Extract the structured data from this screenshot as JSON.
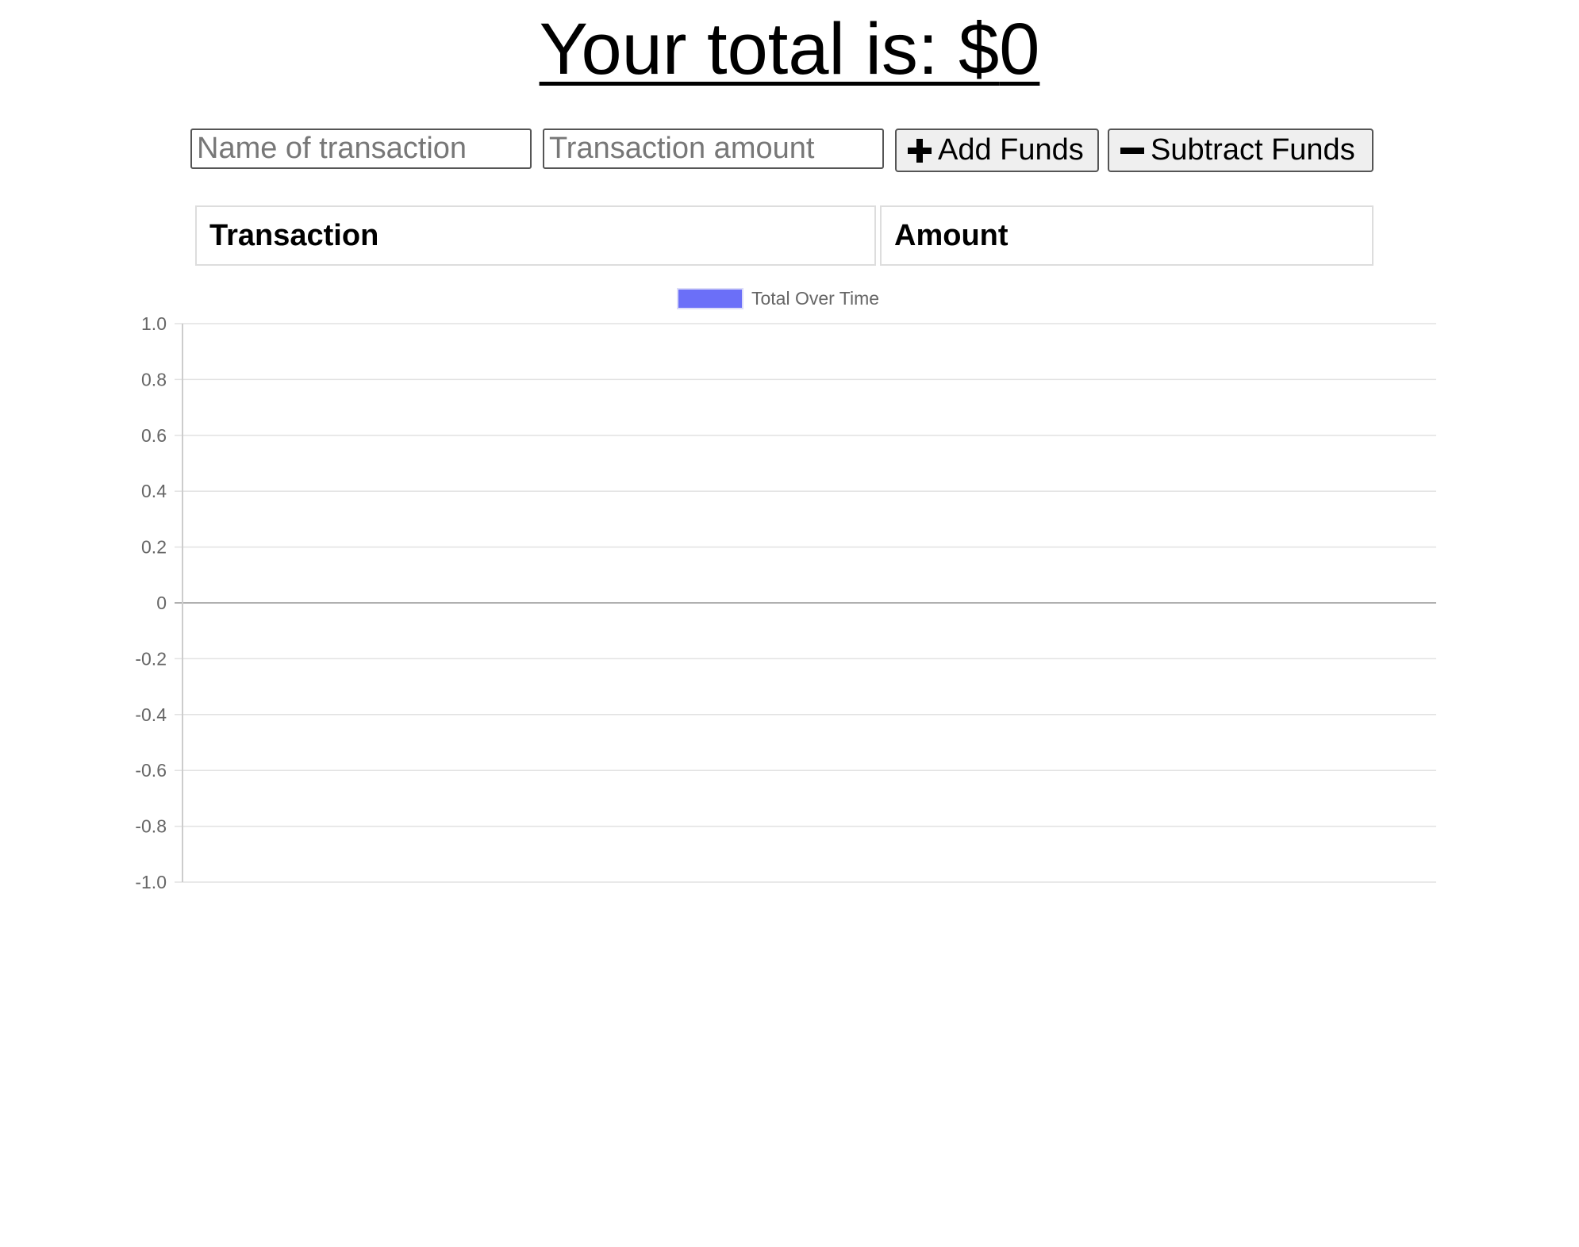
{
  "header": {
    "title_prefix": "Your total is: $",
    "total": "0"
  },
  "form": {
    "name_placeholder": "Name of transaction",
    "amount_placeholder": "Transaction amount",
    "name_value": "",
    "amount_value": "",
    "add_label": "Add Funds",
    "subtract_label": "Subtract Funds"
  },
  "table": {
    "headers": [
      "Transaction",
      "Amount"
    ],
    "rows": []
  },
  "chart_data": {
    "type": "line",
    "title": "",
    "xlabel": "",
    "ylabel": "",
    "series": [
      {
        "name": "Total Over Time",
        "color": "#6b6ff8",
        "values": []
      }
    ],
    "categories": [],
    "ylim": [
      -1.0,
      1.0
    ],
    "yticks": [
      "1.0",
      "0.8",
      "0.6",
      "0.4",
      "0.2",
      "0",
      "-0.2",
      "-0.4",
      "-0.6",
      "-0.8",
      "-1.0"
    ],
    "grid": true,
    "legend_position": "top-center"
  }
}
